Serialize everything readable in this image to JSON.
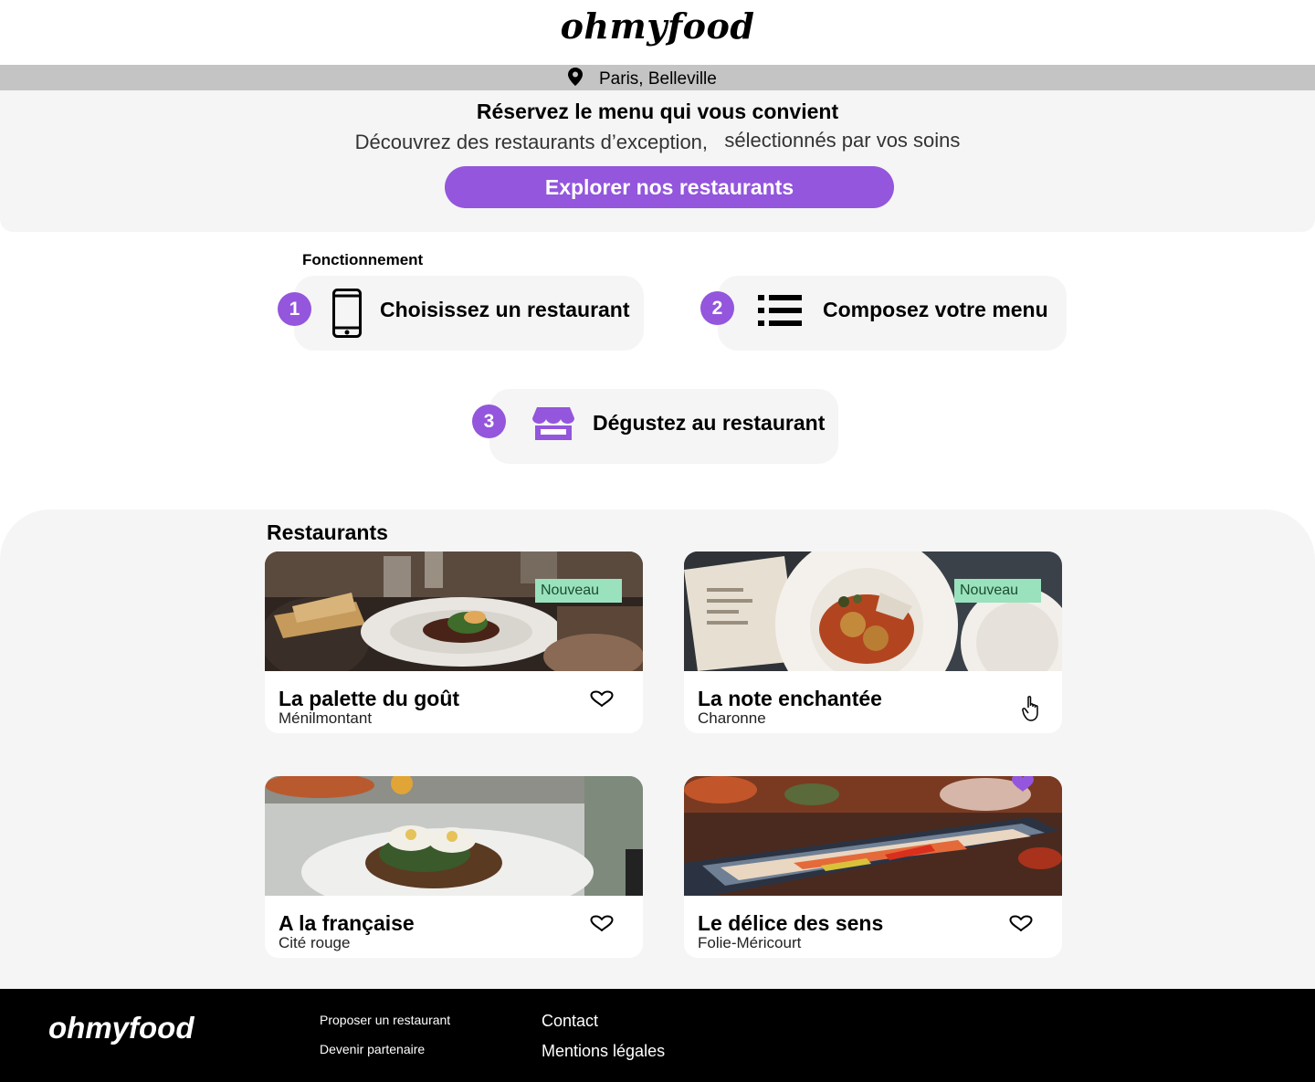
{
  "header": {
    "logo": "ohmyfood"
  },
  "location": {
    "icon": "map-pin-icon",
    "text": "Paris, Belleville"
  },
  "hero": {
    "title": "Réservez le menu qui  vous convient",
    "subtitle_part1": "Découvrez des restaurants d’exception,",
    "subtitle_part2": "sélectionnés par vos soins",
    "button_label": "Explorer nos restaurants"
  },
  "how": {
    "title": "Fonctionnement",
    "steps": [
      {
        "number": "1",
        "label": "Choisissez un restaurant",
        "icon": "smartphone-icon"
      },
      {
        "number": "2",
        "label": "Composez votre menu",
        "icon": "list-icon"
      },
      {
        "number": "3",
        "label": "Dégustez au restaurant",
        "icon": "storefront-icon"
      }
    ]
  },
  "restaurants": {
    "title": "Restaurants",
    "items": [
      {
        "name": "La palette du goût",
        "area": "Ménilmontant",
        "badge": "Nouveau",
        "favorite": false
      },
      {
        "name": "La note enchantée",
        "area": "Charonne",
        "badge": "Nouveau",
        "favorite": false
      },
      {
        "name": "A la française",
        "area": "Cité rouge",
        "badge": "",
        "favorite": false
      },
      {
        "name": "Le délice des sens",
        "area": "Folie-Méricourt",
        "badge": "",
        "favorite": true
      }
    ]
  },
  "footer": {
    "logo": "ohmyfood",
    "links": {
      "propose": "Proposer un restaurant",
      "partner": "Devenir partenaire",
      "contact": "Contact",
      "legal": "Mentions légales"
    }
  },
  "colors": {
    "accent": "#9356dc",
    "badge_bg": "#99e2bd",
    "section_bg": "#f5f5f5",
    "location_bar": "#c4c4c4"
  }
}
